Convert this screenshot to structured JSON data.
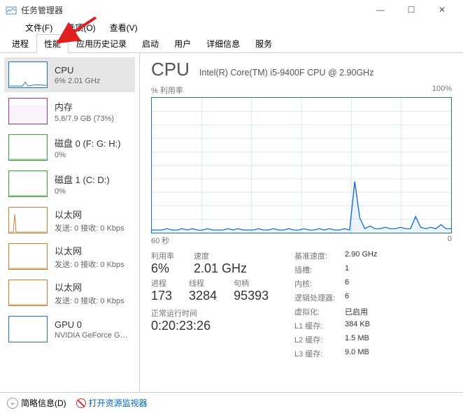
{
  "window": {
    "title": "任务管理器",
    "menu": {
      "file": "文件(F)",
      "options": "选项(O)",
      "view": "查看(V)"
    },
    "buttons": {
      "min": "—",
      "max": "☐",
      "close": "✕"
    }
  },
  "tabs": {
    "processes": "进程",
    "performance": "性能",
    "apphistory": "应用历史记录",
    "startup": "启动",
    "users": "用户",
    "details": "详细信息",
    "services": "服务"
  },
  "sidebar": [
    {
      "title": "CPU",
      "sub": "6% 2.01 GHz",
      "color": "#1a6fcf"
    },
    {
      "title": "内存",
      "sub": "5.8/7.9 GB (73%)",
      "color": "#a030a0"
    },
    {
      "title": "磁盘 0 (F: G: H:)",
      "sub": "0%",
      "color": "#3a9c3a"
    },
    {
      "title": "磁盘 1 (C: D:)",
      "sub": "0%",
      "color": "#3a9c3a"
    },
    {
      "title": "以太网",
      "sub": "发送: 0 接收: 0 Kbps",
      "color": "#c97c2f"
    },
    {
      "title": "以太网",
      "sub": "发送: 0 接收: 0 Kbps",
      "color": "#c97c2f"
    },
    {
      "title": "以太网",
      "sub": "发送: 0 接收: 0 Kbps",
      "color": "#c97c2f"
    },
    {
      "title": "GPU 0",
      "sub": "NVIDIA GeForce G…",
      "color": "#1a6fcf"
    }
  ],
  "main": {
    "title": "CPU",
    "model": "Intel(R) Core(TM) i5-9400F CPU @ 2.90GHz",
    "chart_top_left": "% 利用率",
    "chart_top_right": "100%",
    "chart_bot_left": "60 秒",
    "chart_bot_right": "0",
    "left": {
      "util_lbl": "利用率",
      "util_val": "6%",
      "speed_lbl": "速度",
      "speed_val": "2.01 GHz",
      "proc_lbl": "进程",
      "proc_val": "173",
      "thr_lbl": "线程",
      "thr_val": "3284",
      "hnd_lbl": "句柄",
      "hnd_val": "95393",
      "uptime_lbl": "正常运行时间",
      "uptime_val": "0:20:23:26"
    },
    "right": {
      "base_lbl": "基准速度:",
      "base_val": "2.90 GHz",
      "sock_lbl": "插槽:",
      "sock_val": "1",
      "core_lbl": "内核:",
      "core_val": "6",
      "lproc_lbl": "逻辑处理器:",
      "lproc_val": "6",
      "virt_lbl": "虚拟化:",
      "virt_val": "已启用",
      "l1_lbl": "L1 缓存:",
      "l1_val": "384 KB",
      "l2_lbl": "L2 缓存:",
      "l2_val": "1.5 MB",
      "l3_lbl": "L3 缓存:",
      "l3_val": "9.0 MB"
    }
  },
  "statusbar": {
    "fewer": "简略信息(D)",
    "resmon": "打开资源监视器"
  },
  "chart_data": {
    "type": "line",
    "title": "% 利用率",
    "xlabel": "60 秒",
    "ylabel": "",
    "ylim": [
      0,
      100
    ],
    "x_range_seconds": [
      60,
      0
    ],
    "series": [
      {
        "name": "CPU 利用率 %",
        "values": [
          2,
          2,
          2,
          3,
          2,
          2,
          3,
          2,
          3,
          2,
          2,
          3,
          2,
          2,
          2,
          3,
          2,
          3,
          2,
          2,
          2,
          3,
          2,
          2,
          3,
          2,
          2,
          3,
          2,
          2,
          3,
          2,
          2,
          3,
          2,
          3,
          2,
          2,
          3,
          2,
          38,
          11,
          3,
          5,
          3,
          3,
          4,
          3,
          3,
          4,
          3,
          3,
          12,
          4,
          3,
          4,
          3,
          6,
          3,
          3
        ]
      }
    ]
  }
}
